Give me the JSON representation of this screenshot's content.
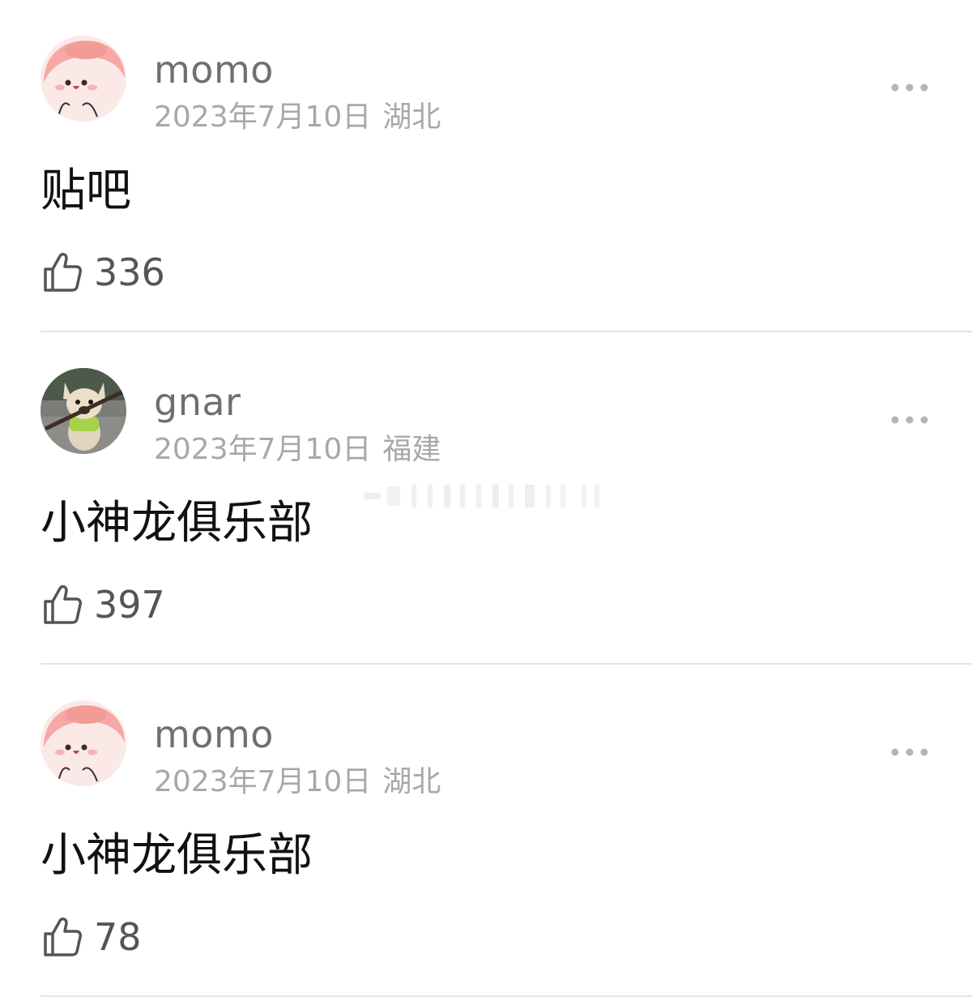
{
  "comments": [
    {
      "username": "momo",
      "date": "2023年7月10日",
      "location": "湖北",
      "text": "贴吧",
      "likes": "336",
      "avatar": "pink-cartoon-face-avatar",
      "more_icon": "more-dots-icon",
      "like_icon": "thumbs-up-icon"
    },
    {
      "username": "gnar",
      "date": "2023年7月10日",
      "location": "福建",
      "text": "小神龙俱乐部",
      "likes": "397",
      "avatar": "french-bulldog-photo-avatar",
      "more_icon": "more-dots-icon",
      "like_icon": "thumbs-up-icon"
    },
    {
      "username": "momo",
      "date": "2023年7月10日",
      "location": "湖北",
      "text": "小神龙俱乐部",
      "likes": "78",
      "avatar": "pink-cartoon-face-avatar",
      "more_icon": "more-dots-icon",
      "like_icon": "thumbs-up-icon"
    }
  ],
  "colors": {
    "username": "#6f6f6f",
    "meta": "#a8a8a8",
    "text": "#111111",
    "like_count": "#555555",
    "divider": "#e4e4e4",
    "avatar_pink": "#f7b3b3"
  }
}
